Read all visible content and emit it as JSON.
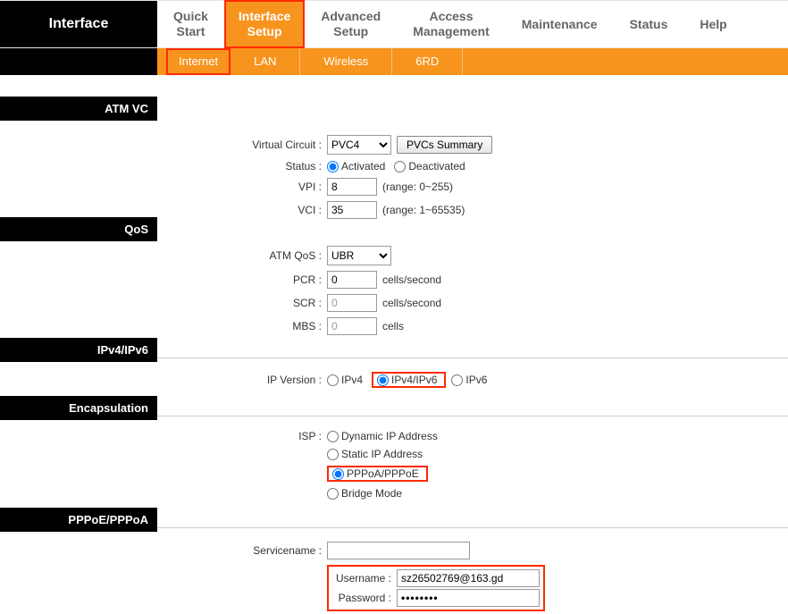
{
  "brand": "Interface",
  "tabs": {
    "quick_start": "Quick\nStart",
    "interface_setup": "Interface\nSetup",
    "advanced_setup": "Advanced\nSetup",
    "access_management": "Access\nManagement",
    "maintenance": "Maintenance",
    "status": "Status",
    "help": "Help"
  },
  "subnav": {
    "internet": "Internet",
    "lan": "LAN",
    "wireless": "Wireless",
    "rd": "6RD"
  },
  "sections": {
    "atmvc": "ATM VC",
    "qos": "QoS",
    "ipv": "IPv4/IPv6",
    "encap": "Encapsulation",
    "ppp": "PPPoE/PPPoA"
  },
  "atm": {
    "vc_label": "Virtual Circuit :",
    "vc_value": "PVC4",
    "pvcs_btn": "PVCs Summary",
    "status_label": "Status :",
    "activated": "Activated",
    "deactivated": "Deactivated",
    "vpi_label": "VPI :",
    "vpi_value": "8",
    "vpi_range": "(range: 0~255)",
    "vci_label": "VCI :",
    "vci_value": "35",
    "vci_range": "(range: 1~65535)"
  },
  "qos": {
    "atmqos_label": "ATM QoS :",
    "atmqos_value": "UBR",
    "pcr_label": "PCR :",
    "pcr_value": "0",
    "pcr_unit": "cells/second",
    "scr_label": "SCR :",
    "scr_value": "0",
    "scr_unit": "cells/second",
    "mbs_label": "MBS :",
    "mbs_value": "0",
    "mbs_unit": "cells"
  },
  "ipv": {
    "label": "IP Version :",
    "opt_v4": "IPv4",
    "opt_v46": "IPv4/IPv6",
    "opt_v6": "IPv6"
  },
  "isp": {
    "label": "ISP :",
    "dyn": "Dynamic IP Address",
    "stat": "Static IP Address",
    "ppp": "PPPoA/PPPoE",
    "bridge": "Bridge Mode"
  },
  "ppp": {
    "svc_label": "Servicename :",
    "svc_value": "",
    "user_label": "Username :",
    "user_value": "sz26502769@163.gd",
    "pass_label": "Password :",
    "pass_value": "••••••••"
  }
}
